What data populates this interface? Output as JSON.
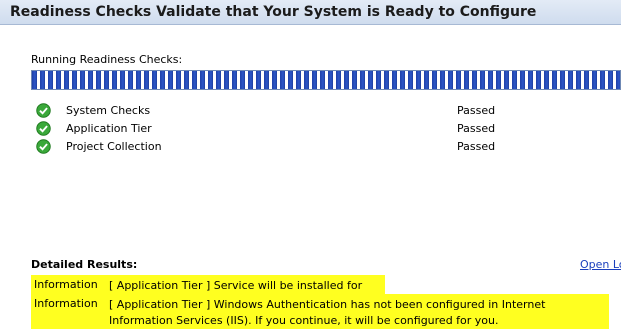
{
  "header": {
    "title": "Readiness Checks Validate that Your System is Ready to Configure"
  },
  "progress": {
    "label": "Running Readiness Checks:",
    "fraction": 1.0
  },
  "checks": [
    {
      "name": "System Checks",
      "status": "Passed",
      "icon": "green-check-icon"
    },
    {
      "name": "Application Tier",
      "status": "Passed",
      "icon": "green-check-icon"
    },
    {
      "name": "Project Collection",
      "status": "Passed",
      "icon": "green-check-icon"
    }
  ],
  "results": {
    "label": "Detailed Results:",
    "open_log_label": "Open Lo",
    "highlight_color": "#ffff20",
    "items": [
      {
        "type": "Information",
        "message": "[ Application Tier ] Service will be installed for you: IIS"
      },
      {
        "type": "Information",
        "message": "[ Application Tier ] Windows Authentication has not been configured in Internet Information Services (IIS). If you continue, it will be configured for you."
      }
    ]
  }
}
